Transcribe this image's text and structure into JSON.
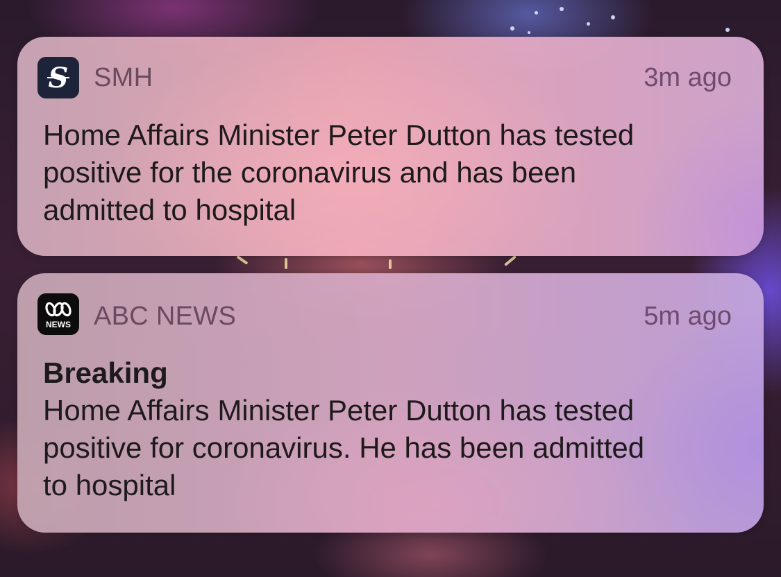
{
  "notifications": [
    {
      "app": "SMH",
      "icon": "smh-logo-icon",
      "icon_glyph": "S",
      "time": "3m ago",
      "message": "Home Affairs Minister Peter Dutton has tested\npositive for the coronavirus and has been\nadmitted to hospital"
    },
    {
      "app": "ABC NEWS",
      "icon": "abc-news-logo-icon",
      "icon_label": "NEWS",
      "time": "5m ago",
      "title": "Breaking",
      "message": "Home Affairs Minister Peter Dutton has tested\npositive for coronavirus. He has been admitted\nto hospital"
    }
  ],
  "colors": {
    "smh_icon_bg": "#1d2439",
    "abc_icon_bg": "#0c0c0c",
    "app_name": "#6a4a5e",
    "body_text": "#1e1a1c"
  }
}
